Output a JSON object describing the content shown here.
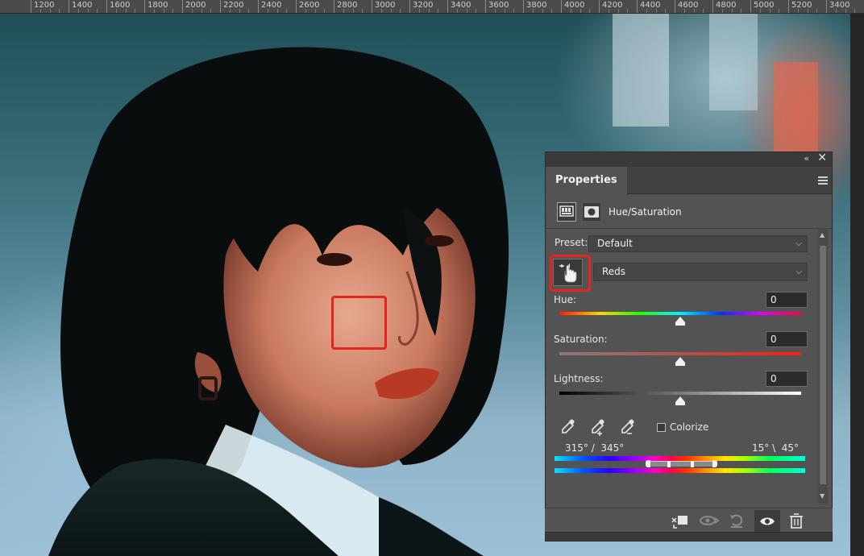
{
  "ruler": {
    "labels": [
      "1200",
      "1400",
      "1600",
      "1800",
      "2000",
      "2200",
      "2400",
      "2600",
      "2800",
      "3000",
      "3200",
      "3400",
      "3600",
      "3800",
      "4000",
      "4200",
      "4400",
      "4600",
      "4800",
      "5000",
      "5200",
      "3400"
    ]
  },
  "panel": {
    "tab_label": "Properties",
    "adjustment_title": "Hue/Saturation",
    "preset_label": "Preset:",
    "preset_value": "Default",
    "channel_value": "Reds",
    "hue_label": "Hue:",
    "hue_value": "0",
    "saturation_label": "Saturation:",
    "saturation_value": "0",
    "lightness_label": "Lightness:",
    "lightness_value": "0",
    "colorize_label": "Colorize",
    "colorize_checked": false,
    "range_left": "315° /  345°",
    "range_right": "15° \\  45°",
    "hue_level": 0.5,
    "saturation_level": 0.5,
    "lightness_level": 0.5
  },
  "colors": {
    "highlight_red": "#e8231f",
    "panel_bg": "#535353"
  },
  "icons": [
    "collapse-icon",
    "close-icon",
    "panel-menu-icon",
    "adjustment-layer-icon",
    "layer-mask-icon",
    "targeted-adjustment-hand-icon",
    "eyedropper-icon",
    "eyedropper-add-icon",
    "eyedropper-subtract-icon",
    "clip-to-layer-icon",
    "view-previous-icon",
    "reset-icon",
    "visibility-eye-icon",
    "trash-icon"
  ]
}
